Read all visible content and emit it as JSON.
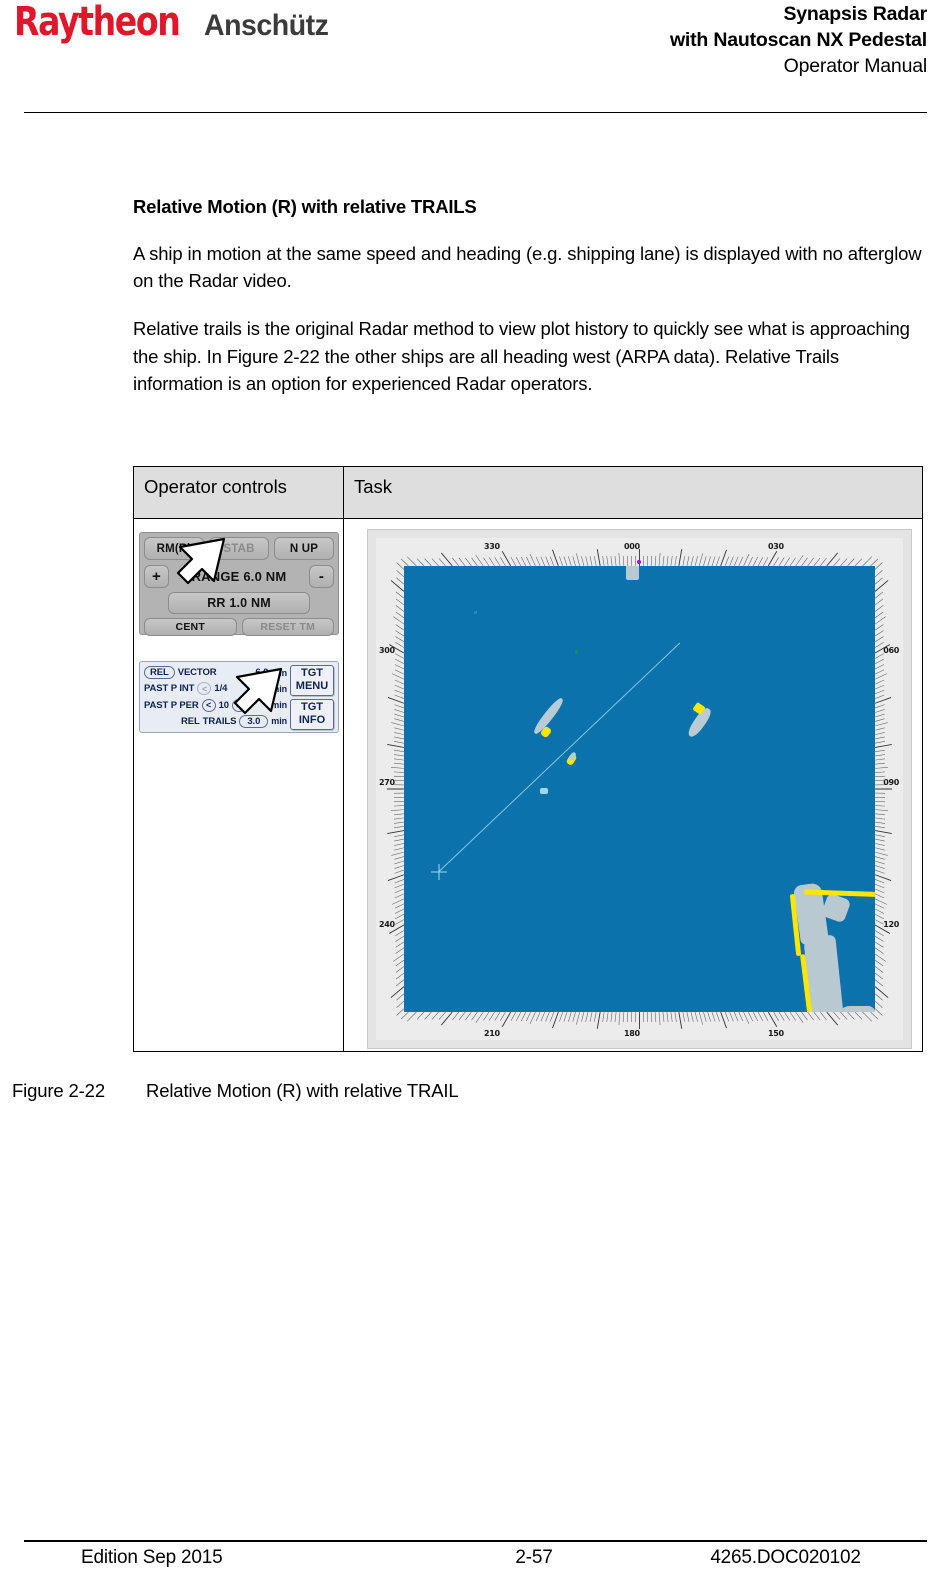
{
  "header": {
    "logo_primary": "Raytheon",
    "logo_secondary": "Anschütz",
    "title_line1": "Synapsis Radar",
    "title_line2": "with Nautoscan NX Pedestal",
    "title_line3": "Operator Manual"
  },
  "content": {
    "section_title": "Relative Motion (R) with relative TRAILS",
    "paragraph1": "A ship in motion at the same speed and heading (e.g. shipping lane) is displayed with no afterglow on the Radar video.",
    "paragraph2": "Relative trails is the original Radar method to view plot history to quickly see what is approaching the ship. In Figure 2-22 the other ships are all heading west (ARPA data). Relative Trails information is an option for experienced Radar operators."
  },
  "table": {
    "header_controls": "Operator controls",
    "header_task": "Task"
  },
  "controls": {
    "top_panel": {
      "motion_mode": "RM(R)",
      "stabilization": "STAB",
      "orientation": "N UP",
      "plus": "+",
      "minus": "-",
      "range": "RANGE 6.0 NM",
      "range_ring": "RR 1.0 NM",
      "centre": "CENT",
      "reset_tm": "RESET TM"
    },
    "bottom_panel": {
      "vector_mode": "REL",
      "vector_label": "VECTOR",
      "vector_value": "6.0",
      "vector_unit": "min",
      "past_p_int_label": "PAST P INT",
      "past_p_int_value": "1/4",
      "past_p_int_unit": "min",
      "past_p_per_label": "PAST P PER",
      "past_p_per_value": "10",
      "past_p_per_unit": "min",
      "trails_mode": "REL",
      "trails_label": "TRAILS",
      "trails_value": "3.0",
      "trails_unit": "min",
      "tgt_menu_line1": "TGT",
      "tgt_menu_line2": "MENU",
      "tgt_info_line1": "TGT",
      "tgt_info_line2": "INFO",
      "prev_arrow": "<",
      "next_arrow": ">"
    }
  },
  "radar": {
    "bearing_labels": {
      "top_left": "330",
      "top_centre": "000",
      "top_right": "030",
      "right_upper": "060",
      "right_middle": "090",
      "right_lower": "120",
      "bottom_right": "150",
      "bottom_centre": "180",
      "bottom_left": "210",
      "left_lower": "240",
      "left_middle": "270",
      "left_upper": "300"
    },
    "colors": {
      "sea": "#0c72ac",
      "land": "#b9c9d2",
      "target_head": "#ffe600",
      "trail": "#ffe600",
      "vector_line": "#7ec8ef",
      "heading_marker": "#c000c0",
      "scale_ring": "#ececec"
    }
  },
  "figure": {
    "number": "Figure 2-22",
    "caption": "Relative Motion (R) with relative TRAIL"
  },
  "footer": {
    "edition": "Edition Sep 2015",
    "page": "2-57",
    "doc": "4265.DOC020102"
  }
}
